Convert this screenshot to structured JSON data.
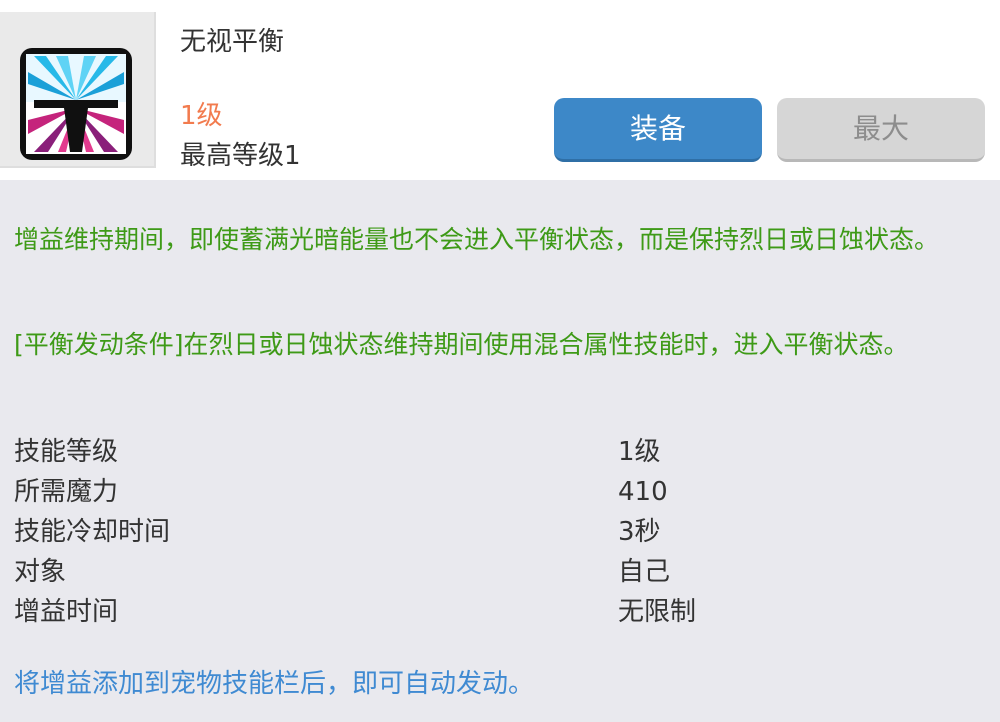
{
  "skill": {
    "name": "无视平衡",
    "level": "1级",
    "max_level": "最高等级1",
    "icon": "balance-skill-icon"
  },
  "buttons": {
    "equip": "装备",
    "max": "最大"
  },
  "description": {
    "line1": "增益维持期间，即使蓄满光暗能量也不会进入平衡状态，而是保持烈日或日蚀状态。",
    "line2": "[平衡发动条件]在烈日或日蚀状态维持期间使用混合属性技能时，进入平衡状态。"
  },
  "stats": [
    {
      "label": "技能等级",
      "value": "1级"
    },
    {
      "label": "所需魔力",
      "value": "410"
    },
    {
      "label": "技能冷却时间",
      "value": "3秒"
    },
    {
      "label": "对象",
      "value": "自己"
    },
    {
      "label": "增益时间",
      "value": "无限制"
    }
  ],
  "note": "将增益添加到宠物技能栏后，即可自动发动。",
  "colors": {
    "level": "#f27b4e",
    "description": "#3e9a17",
    "note": "#3f8ad2",
    "equip_button": "#3d88c8",
    "max_button": "#d6d6d6"
  }
}
